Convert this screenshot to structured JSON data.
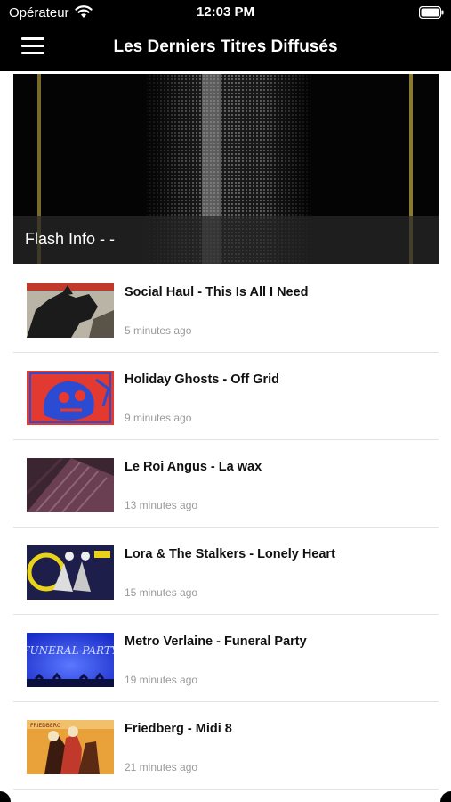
{
  "status_bar": {
    "carrier": "Opérateur",
    "time": "12:03 PM"
  },
  "nav": {
    "title": "Les Derniers Titres Diffusés"
  },
  "hero": {
    "caption": "Flash Info - -"
  },
  "tracks": [
    {
      "title": "Social Haul - This Is All I Need",
      "time": "5 minutes ago"
    },
    {
      "title": "Holiday Ghosts - Off Grid",
      "time": "9 minutes ago"
    },
    {
      "title": "Le Roi Angus - La wax",
      "time": "13 minutes ago"
    },
    {
      "title": "Lora & The Stalkers - Lonely Heart",
      "time": "15 minutes ago"
    },
    {
      "title": "Metro Verlaine - Funeral Party",
      "time": "19 minutes ago"
    },
    {
      "title": "Friedberg - Midi 8",
      "time": "21 minutes ago"
    }
  ],
  "artwork_text": {
    "funeral_party": "FUNERAL PARTY",
    "friedberg": "FRIEDBERG"
  }
}
